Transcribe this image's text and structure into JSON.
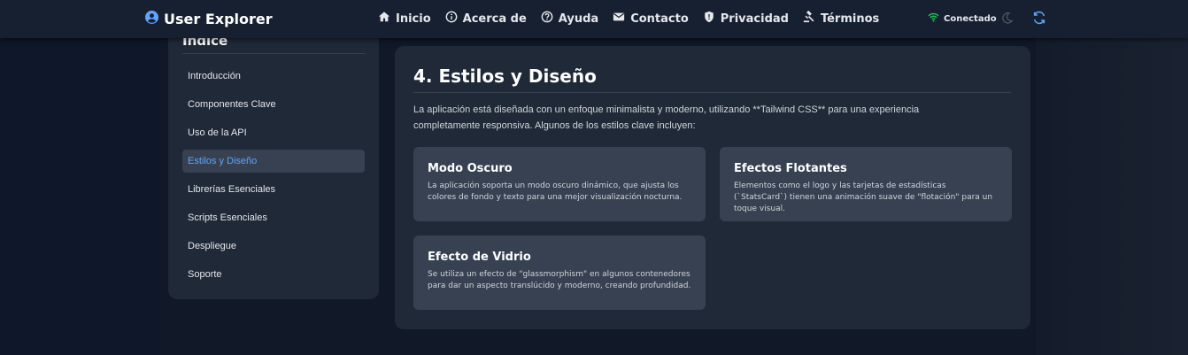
{
  "navbar": {
    "brand": "User Explorer",
    "links": [
      {
        "label": "Inicio",
        "icon": "home-icon"
      },
      {
        "label": "Acerca de",
        "icon": "info-icon"
      },
      {
        "label": "Ayuda",
        "icon": "help-icon"
      },
      {
        "label": "Contacto",
        "icon": "envelope-icon"
      },
      {
        "label": "Privacidad",
        "icon": "shield-icon"
      },
      {
        "label": "Términos",
        "icon": "gavel-icon"
      }
    ],
    "status": "Conectado",
    "status_color": "#22c55e",
    "accent": "#60a5fa"
  },
  "sidebar": {
    "title": "Índice",
    "items": [
      "Introducción",
      "Componentes Clave",
      "Uso de la API",
      "Estilos y Diseño",
      "Librerías Esenciales",
      "Scripts Esenciales",
      "Despliegue",
      "Soporte"
    ],
    "active_index": 3
  },
  "main": {
    "title": "4. Estilos y Diseño",
    "description": "La aplicación está diseñada con un enfoque minimalista y moderno, utilizando **Tailwind CSS** para una experiencia completamente responsiva. Algunos de los estilos clave incluyen:",
    "cards": [
      {
        "title": "Modo Oscuro",
        "text": "La aplicación soporta un modo oscuro dinámico, que ajusta los colores de fondo y texto para una mejor visualización nocturna."
      },
      {
        "title": "Efectos Flotantes",
        "text": "Elementos como el logo y las tarjetas de estadísticas (`StatsCard`) tienen una animación suave de \"flotación\" para un toque visual."
      },
      {
        "title": "Efecto de Vidrio",
        "text": "Se utiliza un efecto de \"glassmorphism\" en algunos contenedores para dar un aspecto translúcido y moderno, creando profundidad."
      }
    ]
  }
}
